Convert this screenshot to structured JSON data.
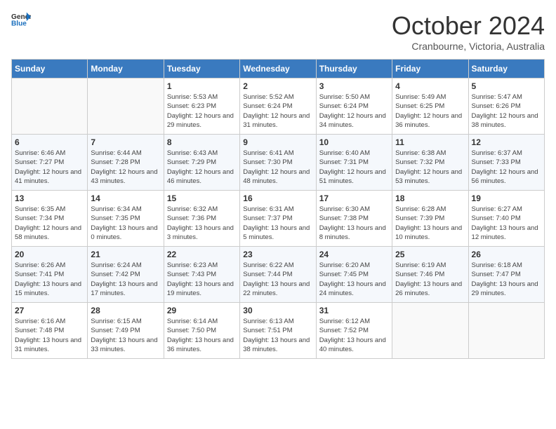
{
  "header": {
    "logo": {
      "general": "General",
      "blue": "Blue"
    },
    "title": "October 2024",
    "location": "Cranbourne, Victoria, Australia"
  },
  "weekdays": [
    "Sunday",
    "Monday",
    "Tuesday",
    "Wednesday",
    "Thursday",
    "Friday",
    "Saturday"
  ],
  "weeks": [
    [
      {
        "day": "",
        "empty": true
      },
      {
        "day": "",
        "empty": true
      },
      {
        "day": "1",
        "sunrise": "Sunrise: 5:53 AM",
        "sunset": "Sunset: 6:23 PM",
        "daylight": "Daylight: 12 hours and 29 minutes."
      },
      {
        "day": "2",
        "sunrise": "Sunrise: 5:52 AM",
        "sunset": "Sunset: 6:24 PM",
        "daylight": "Daylight: 12 hours and 31 minutes."
      },
      {
        "day": "3",
        "sunrise": "Sunrise: 5:50 AM",
        "sunset": "Sunset: 6:24 PM",
        "daylight": "Daylight: 12 hours and 34 minutes."
      },
      {
        "day": "4",
        "sunrise": "Sunrise: 5:49 AM",
        "sunset": "Sunset: 6:25 PM",
        "daylight": "Daylight: 12 hours and 36 minutes."
      },
      {
        "day": "5",
        "sunrise": "Sunrise: 5:47 AM",
        "sunset": "Sunset: 6:26 PM",
        "daylight": "Daylight: 12 hours and 38 minutes."
      }
    ],
    [
      {
        "day": "6",
        "sunrise": "Sunrise: 6:46 AM",
        "sunset": "Sunset: 7:27 PM",
        "daylight": "Daylight: 12 hours and 41 minutes."
      },
      {
        "day": "7",
        "sunrise": "Sunrise: 6:44 AM",
        "sunset": "Sunset: 7:28 PM",
        "daylight": "Daylight: 12 hours and 43 minutes."
      },
      {
        "day": "8",
        "sunrise": "Sunrise: 6:43 AM",
        "sunset": "Sunset: 7:29 PM",
        "daylight": "Daylight: 12 hours and 46 minutes."
      },
      {
        "day": "9",
        "sunrise": "Sunrise: 6:41 AM",
        "sunset": "Sunset: 7:30 PM",
        "daylight": "Daylight: 12 hours and 48 minutes."
      },
      {
        "day": "10",
        "sunrise": "Sunrise: 6:40 AM",
        "sunset": "Sunset: 7:31 PM",
        "daylight": "Daylight: 12 hours and 51 minutes."
      },
      {
        "day": "11",
        "sunrise": "Sunrise: 6:38 AM",
        "sunset": "Sunset: 7:32 PM",
        "daylight": "Daylight: 12 hours and 53 minutes."
      },
      {
        "day": "12",
        "sunrise": "Sunrise: 6:37 AM",
        "sunset": "Sunset: 7:33 PM",
        "daylight": "Daylight: 12 hours and 56 minutes."
      }
    ],
    [
      {
        "day": "13",
        "sunrise": "Sunrise: 6:35 AM",
        "sunset": "Sunset: 7:34 PM",
        "daylight": "Daylight: 12 hours and 58 minutes."
      },
      {
        "day": "14",
        "sunrise": "Sunrise: 6:34 AM",
        "sunset": "Sunset: 7:35 PM",
        "daylight": "Daylight: 13 hours and 0 minutes."
      },
      {
        "day": "15",
        "sunrise": "Sunrise: 6:32 AM",
        "sunset": "Sunset: 7:36 PM",
        "daylight": "Daylight: 13 hours and 3 minutes."
      },
      {
        "day": "16",
        "sunrise": "Sunrise: 6:31 AM",
        "sunset": "Sunset: 7:37 PM",
        "daylight": "Daylight: 13 hours and 5 minutes."
      },
      {
        "day": "17",
        "sunrise": "Sunrise: 6:30 AM",
        "sunset": "Sunset: 7:38 PM",
        "daylight": "Daylight: 13 hours and 8 minutes."
      },
      {
        "day": "18",
        "sunrise": "Sunrise: 6:28 AM",
        "sunset": "Sunset: 7:39 PM",
        "daylight": "Daylight: 13 hours and 10 minutes."
      },
      {
        "day": "19",
        "sunrise": "Sunrise: 6:27 AM",
        "sunset": "Sunset: 7:40 PM",
        "daylight": "Daylight: 13 hours and 12 minutes."
      }
    ],
    [
      {
        "day": "20",
        "sunrise": "Sunrise: 6:26 AM",
        "sunset": "Sunset: 7:41 PM",
        "daylight": "Daylight: 13 hours and 15 minutes."
      },
      {
        "day": "21",
        "sunrise": "Sunrise: 6:24 AM",
        "sunset": "Sunset: 7:42 PM",
        "daylight": "Daylight: 13 hours and 17 minutes."
      },
      {
        "day": "22",
        "sunrise": "Sunrise: 6:23 AM",
        "sunset": "Sunset: 7:43 PM",
        "daylight": "Daylight: 13 hours and 19 minutes."
      },
      {
        "day": "23",
        "sunrise": "Sunrise: 6:22 AM",
        "sunset": "Sunset: 7:44 PM",
        "daylight": "Daylight: 13 hours and 22 minutes."
      },
      {
        "day": "24",
        "sunrise": "Sunrise: 6:20 AM",
        "sunset": "Sunset: 7:45 PM",
        "daylight": "Daylight: 13 hours and 24 minutes."
      },
      {
        "day": "25",
        "sunrise": "Sunrise: 6:19 AM",
        "sunset": "Sunset: 7:46 PM",
        "daylight": "Daylight: 13 hours and 26 minutes."
      },
      {
        "day": "26",
        "sunrise": "Sunrise: 6:18 AM",
        "sunset": "Sunset: 7:47 PM",
        "daylight": "Daylight: 13 hours and 29 minutes."
      }
    ],
    [
      {
        "day": "27",
        "sunrise": "Sunrise: 6:16 AM",
        "sunset": "Sunset: 7:48 PM",
        "daylight": "Daylight: 13 hours and 31 minutes."
      },
      {
        "day": "28",
        "sunrise": "Sunrise: 6:15 AM",
        "sunset": "Sunset: 7:49 PM",
        "daylight": "Daylight: 13 hours and 33 minutes."
      },
      {
        "day": "29",
        "sunrise": "Sunrise: 6:14 AM",
        "sunset": "Sunset: 7:50 PM",
        "daylight": "Daylight: 13 hours and 36 minutes."
      },
      {
        "day": "30",
        "sunrise": "Sunrise: 6:13 AM",
        "sunset": "Sunset: 7:51 PM",
        "daylight": "Daylight: 13 hours and 38 minutes."
      },
      {
        "day": "31",
        "sunrise": "Sunrise: 6:12 AM",
        "sunset": "Sunset: 7:52 PM",
        "daylight": "Daylight: 13 hours and 40 minutes."
      },
      {
        "day": "",
        "empty": true
      },
      {
        "day": "",
        "empty": true
      }
    ]
  ]
}
